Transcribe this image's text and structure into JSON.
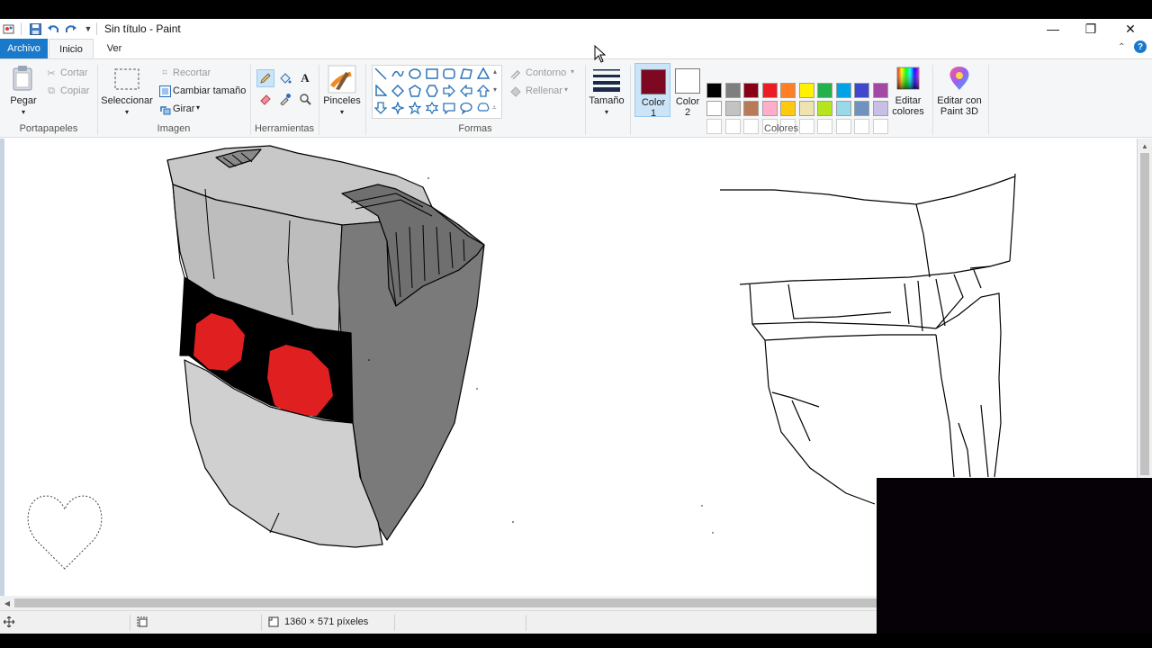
{
  "window": {
    "title": "Sin título - Paint",
    "controls": {
      "minimize": "—",
      "restore": "❐",
      "close": "✕"
    }
  },
  "menu": {
    "file": "Archivo",
    "home": "Inicio",
    "view": "Ver",
    "help": "?"
  },
  "ribbon": {
    "clipboard": {
      "group": "Portapapeles",
      "paste": "Pegar",
      "cut": "Cortar",
      "copy": "Copiar"
    },
    "image": {
      "group": "Imagen",
      "select": "Seleccionar",
      "crop": "Recortar",
      "resize": "Cambiar tamaño",
      "rotate": "Girar"
    },
    "tools": {
      "group": "Herramientas"
    },
    "brushes": {
      "label": "Pinceles"
    },
    "shapes": {
      "group": "Formas",
      "outline": "Contorno",
      "fill": "Rellenar"
    },
    "size": {
      "label": "Tamaño"
    },
    "colors": {
      "group": "Colores",
      "color1_label": "Color\n1",
      "color2_label": "Color\n2",
      "color1": "#7d0821",
      "color2": "#ffffff",
      "edit_colors": "Editar colores",
      "paint3d": "Editar con Paint 3D",
      "palette_row1": [
        "#000000",
        "#7f7f7f",
        "#880015",
        "#ed1c24",
        "#ff7f27",
        "#fff200",
        "#22b14c",
        "#00a2e8",
        "#3f48cc",
        "#a349a4"
      ],
      "palette_row2": [
        "#ffffff",
        "#c3c3c3",
        "#b97a57",
        "#ffaec9",
        "#ffc90e",
        "#efe4b0",
        "#b5e61d",
        "#99d9ea",
        "#7092be",
        "#c8bfe7"
      ],
      "palette_row3": [
        "#ffffff",
        "#ffffff",
        "#ffffff",
        "#ffffff",
        "#ffffff",
        "#ffffff",
        "#ffffff",
        "#ffffff",
        "#ffffff",
        "#ffffff"
      ]
    }
  },
  "status": {
    "dimensions": "1360 × 571 píxeles"
  }
}
